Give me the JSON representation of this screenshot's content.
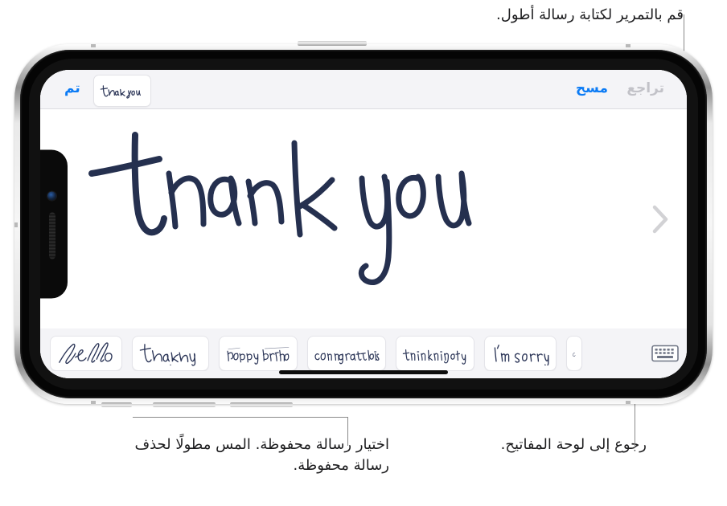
{
  "callouts": {
    "scroll_longer": "قم بالتمرير لكتابة رسالة أطول.",
    "pick_saved": "اختيار رسالة محفوظة. المس مطولًا لحذف رسالة محفوظة.",
    "back_keyboard": "رجوع إلى لوحة المفاتيح."
  },
  "navbar": {
    "undo_label": "تراجع",
    "clear_label": "مسح",
    "done_label": "تم",
    "thumbnail_text": "thank you"
  },
  "canvas": {
    "handwriting_text": "thank you",
    "ink_color": "#25304f",
    "next_arrow": "chevron-right-icon"
  },
  "suggestions": {
    "items": [
      {
        "text": "hello",
        "style": "script"
      },
      {
        "text": "thank you",
        "style": "print"
      },
      {
        "text": "happy birthday",
        "style": "small-script"
      },
      {
        "text": "congratulations",
        "style": "condensed"
      },
      {
        "text": "thinking of you",
        "style": "condensed"
      },
      {
        "text": "I'm sorry",
        "style": "print"
      },
      {
        "text": "",
        "style": "partial"
      }
    ],
    "keyboard_button": "keyboard-icon"
  },
  "colors": {
    "accent_blue": "#0b7bf5",
    "disabled_gray": "#c2c2c8",
    "ink_navy": "#25304f",
    "bar_background": "#f4f4f7",
    "leader_line": "#8a8a8a"
  }
}
